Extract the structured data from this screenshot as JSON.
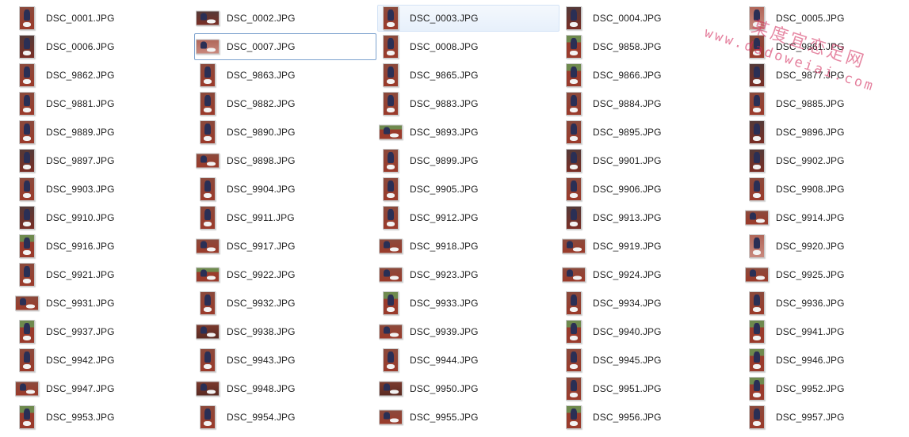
{
  "explorer": {
    "view": "Content/Tiles",
    "items": [
      {
        "name": "DSC_0001.JPG",
        "thumb": "portrait",
        "tone": "red"
      },
      {
        "name": "DSC_0002.JPG",
        "thumb": "landscape",
        "tone": "dark"
      },
      {
        "name": "DSC_0003.JPG",
        "thumb": "portrait",
        "tone": "red",
        "selected": true
      },
      {
        "name": "DSC_0004.JPG",
        "thumb": "portrait",
        "tone": "dark"
      },
      {
        "name": "DSC_0005.JPG",
        "thumb": "portrait",
        "tone": "light"
      },
      {
        "name": "DSC_0006.JPG",
        "thumb": "portrait",
        "tone": "dark"
      },
      {
        "name": "DSC_0007.JPG",
        "thumb": "landscape",
        "tone": "light",
        "focused": true
      },
      {
        "name": "DSC_0008.JPG",
        "thumb": "portrait",
        "tone": "red"
      },
      {
        "name": "DSC_9858.JPG",
        "thumb": "portrait",
        "tone": "green"
      },
      {
        "name": "DSC_9861.JPG",
        "thumb": "portrait",
        "tone": "red"
      },
      {
        "name": "DSC_9862.JPG",
        "thumb": "portrait",
        "tone": "red"
      },
      {
        "name": "DSC_9863.JPG",
        "thumb": "portrait",
        "tone": "red"
      },
      {
        "name": "DSC_9865.JPG",
        "thumb": "portrait",
        "tone": "red"
      },
      {
        "name": "DSC_9866.JPG",
        "thumb": "portrait",
        "tone": "green"
      },
      {
        "name": "DSC_9877.JPG",
        "thumb": "portrait",
        "tone": "dark"
      },
      {
        "name": "DSC_9881.JPG",
        "thumb": "portrait",
        "tone": "red"
      },
      {
        "name": "DSC_9882.JPG",
        "thumb": "portrait",
        "tone": "red"
      },
      {
        "name": "DSC_9883.JPG",
        "thumb": "portrait",
        "tone": "red"
      },
      {
        "name": "DSC_9884.JPG",
        "thumb": "portrait",
        "tone": "red"
      },
      {
        "name": "DSC_9885.JPG",
        "thumb": "portrait",
        "tone": "red"
      },
      {
        "name": "DSC_9889.JPG",
        "thumb": "portrait",
        "tone": "red"
      },
      {
        "name": "DSC_9890.JPG",
        "thumb": "portrait",
        "tone": "red"
      },
      {
        "name": "DSC_9893.JPG",
        "thumb": "landscape",
        "tone": "green"
      },
      {
        "name": "DSC_9895.JPG",
        "thumb": "portrait",
        "tone": "red"
      },
      {
        "name": "DSC_9896.JPG",
        "thumb": "portrait",
        "tone": "dark"
      },
      {
        "name": "DSC_9897.JPG",
        "thumb": "portrait",
        "tone": "dark"
      },
      {
        "name": "DSC_9898.JPG",
        "thumb": "landscape",
        "tone": "red"
      },
      {
        "name": "DSC_9899.JPG",
        "thumb": "portrait",
        "tone": "red"
      },
      {
        "name": "DSC_9901.JPG",
        "thumb": "portrait",
        "tone": "dark"
      },
      {
        "name": "DSC_9902.JPG",
        "thumb": "portrait",
        "tone": "dark"
      },
      {
        "name": "DSC_9903.JPG",
        "thumb": "portrait",
        "tone": "red"
      },
      {
        "name": "DSC_9904.JPG",
        "thumb": "portrait",
        "tone": "red"
      },
      {
        "name": "DSC_9905.JPG",
        "thumb": "portrait",
        "tone": "red"
      },
      {
        "name": "DSC_9906.JPG",
        "thumb": "portrait",
        "tone": "red"
      },
      {
        "name": "DSC_9908.JPG",
        "thumb": "portrait",
        "tone": "red"
      },
      {
        "name": "DSC_9910.JPG",
        "thumb": "portrait",
        "tone": "dark"
      },
      {
        "name": "DSC_9911.JPG",
        "thumb": "portrait",
        "tone": "red"
      },
      {
        "name": "DSC_9912.JPG",
        "thumb": "portrait",
        "tone": "red"
      },
      {
        "name": "DSC_9913.JPG",
        "thumb": "portrait",
        "tone": "dark"
      },
      {
        "name": "DSC_9914.JPG",
        "thumb": "landscape",
        "tone": "red"
      },
      {
        "name": "DSC_9916.JPG",
        "thumb": "portrait",
        "tone": "green"
      },
      {
        "name": "DSC_9917.JPG",
        "thumb": "landscape",
        "tone": "red"
      },
      {
        "name": "DSC_9918.JPG",
        "thumb": "landscape",
        "tone": "red"
      },
      {
        "name": "DSC_9919.JPG",
        "thumb": "landscape",
        "tone": "red"
      },
      {
        "name": "DSC_9920.JPG",
        "thumb": "portrait",
        "tone": "light"
      },
      {
        "name": "DSC_9921.JPG",
        "thumb": "portrait",
        "tone": "red"
      },
      {
        "name": "DSC_9922.JPG",
        "thumb": "landscape",
        "tone": "green"
      },
      {
        "name": "DSC_9923.JPG",
        "thumb": "landscape",
        "tone": "red"
      },
      {
        "name": "DSC_9924.JPG",
        "thumb": "landscape",
        "tone": "red"
      },
      {
        "name": "DSC_9925.JPG",
        "thumb": "landscape",
        "tone": "red"
      },
      {
        "name": "DSC_9931.JPG",
        "thumb": "landscape",
        "tone": "red"
      },
      {
        "name": "DSC_9932.JPG",
        "thumb": "portrait",
        "tone": "red"
      },
      {
        "name": "DSC_9933.JPG",
        "thumb": "portrait",
        "tone": "green"
      },
      {
        "name": "DSC_9934.JPG",
        "thumb": "portrait",
        "tone": "red"
      },
      {
        "name": "DSC_9936.JPG",
        "thumb": "portrait",
        "tone": "red"
      },
      {
        "name": "DSC_9937.JPG",
        "thumb": "portrait",
        "tone": "green"
      },
      {
        "name": "DSC_9938.JPG",
        "thumb": "landscape",
        "tone": "brown"
      },
      {
        "name": "DSC_9939.JPG",
        "thumb": "landscape",
        "tone": "red"
      },
      {
        "name": "DSC_9940.JPG",
        "thumb": "portrait",
        "tone": "green"
      },
      {
        "name": "DSC_9941.JPG",
        "thumb": "portrait",
        "tone": "green"
      },
      {
        "name": "DSC_9942.JPG",
        "thumb": "portrait",
        "tone": "red"
      },
      {
        "name": "DSC_9943.JPG",
        "thumb": "portrait",
        "tone": "red"
      },
      {
        "name": "DSC_9944.JPG",
        "thumb": "portrait",
        "tone": "red"
      },
      {
        "name": "DSC_9945.JPG",
        "thumb": "portrait",
        "tone": "red"
      },
      {
        "name": "DSC_9946.JPG",
        "thumb": "portrait",
        "tone": "green"
      },
      {
        "name": "DSC_9947.JPG",
        "thumb": "landscape",
        "tone": "red"
      },
      {
        "name": "DSC_9948.JPG",
        "thumb": "landscape",
        "tone": "brown"
      },
      {
        "name": "DSC_9950.JPG",
        "thumb": "landscape",
        "tone": "brown"
      },
      {
        "name": "DSC_9951.JPG",
        "thumb": "portrait",
        "tone": "red"
      },
      {
        "name": "DSC_9952.JPG",
        "thumb": "portrait",
        "tone": "green"
      },
      {
        "name": "DSC_9953.JPG",
        "thumb": "portrait",
        "tone": "green"
      },
      {
        "name": "DSC_9954.JPG",
        "thumb": "portrait",
        "tone": "red"
      },
      {
        "name": "DSC_9955.JPG",
        "thumb": "landscape",
        "tone": "red"
      },
      {
        "name": "DSC_9956.JPG",
        "thumb": "portrait",
        "tone": "green"
      },
      {
        "name": "DSC_9957.JPG",
        "thumb": "portrait",
        "tone": "red"
      }
    ]
  },
  "watermark": {
    "title": "某度宜恋足网",
    "url": "www.dadoweiai.com"
  },
  "colors": {
    "background": "#ffffff",
    "text": "#1e1e1e",
    "selection_fill": "#e7f0fb",
    "selection_border": "#d3e3f6",
    "focus_border": "#7da2ce",
    "watermark": "#d2285a"
  }
}
